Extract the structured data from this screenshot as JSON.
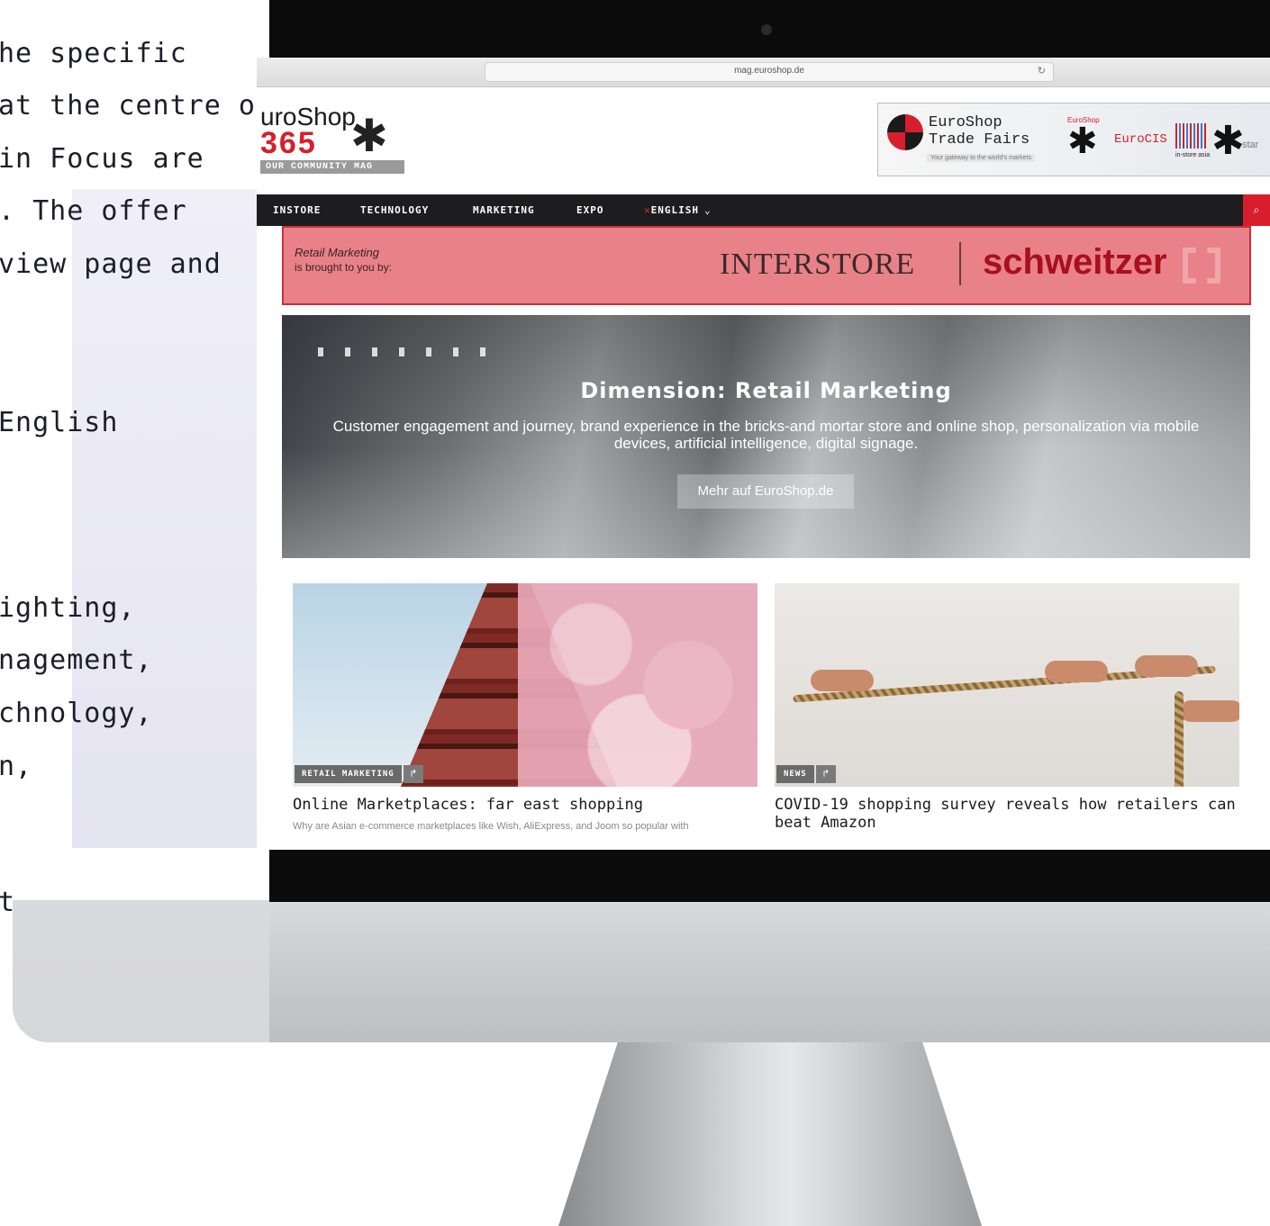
{
  "background_text": [
    "he specific",
    "at the centre of",
    "in Focus are",
    ". The offer",
    "view page and",
    "English",
    "ighting,",
    "nagement,",
    "chnology,",
    "n,",
    "t"
  ],
  "browser": {
    "url": "mag.euroshop.de",
    "reload_icon": "reload-icon"
  },
  "site": {
    "logo_word": "uroShop",
    "logo_number": "365",
    "logo_tagline": "OUR COMMUNITY MAG",
    "banner": {
      "title_line1": "EuroShop",
      "title_line2": "Trade Fairs",
      "subtitle": "Your gateway to the world's markets",
      "euroshop_small": "EuroShop",
      "eurocis": "EuroCIS",
      "instore": "in-store asia",
      "star_suffix": "star"
    }
  },
  "nav": {
    "items": [
      "INSTORE",
      "TECHNOLOGY",
      "MARKETING",
      "EXPO",
      "ENGLISH"
    ],
    "language_flag": "uk-flag-icon",
    "search_icon": "search-icon"
  },
  "sponsor": {
    "line1": "Retail Marketing",
    "line2": "is brought to you by:",
    "brand1": "INTERSTORE",
    "brand2": "schweitzer"
  },
  "hero": {
    "title": "Dimension: Retail Marketing",
    "description": "Customer engagement and journey, brand experience in the bricks-and mortar store and online shop, personalization via mobile devices, artificial intelligence, digital signage.",
    "button": "Mehr auf EuroShop.de"
  },
  "articles": [
    {
      "category": "RETAIL MARKETING",
      "title": "Online Marketplaces: far east shopping",
      "excerpt": "Why are Asian e-commerce marketplaces like Wish, AliExpress, and Joom so popular with"
    },
    {
      "category": "NEWS",
      "title": "COVID-19 shopping survey reveals how retailers can beat Amazon",
      "excerpt": ""
    }
  ],
  "colors": {
    "brand_red": "#d81e2c",
    "nav_bg": "#1d1d1f",
    "sponsor_bg": "#e98188"
  }
}
